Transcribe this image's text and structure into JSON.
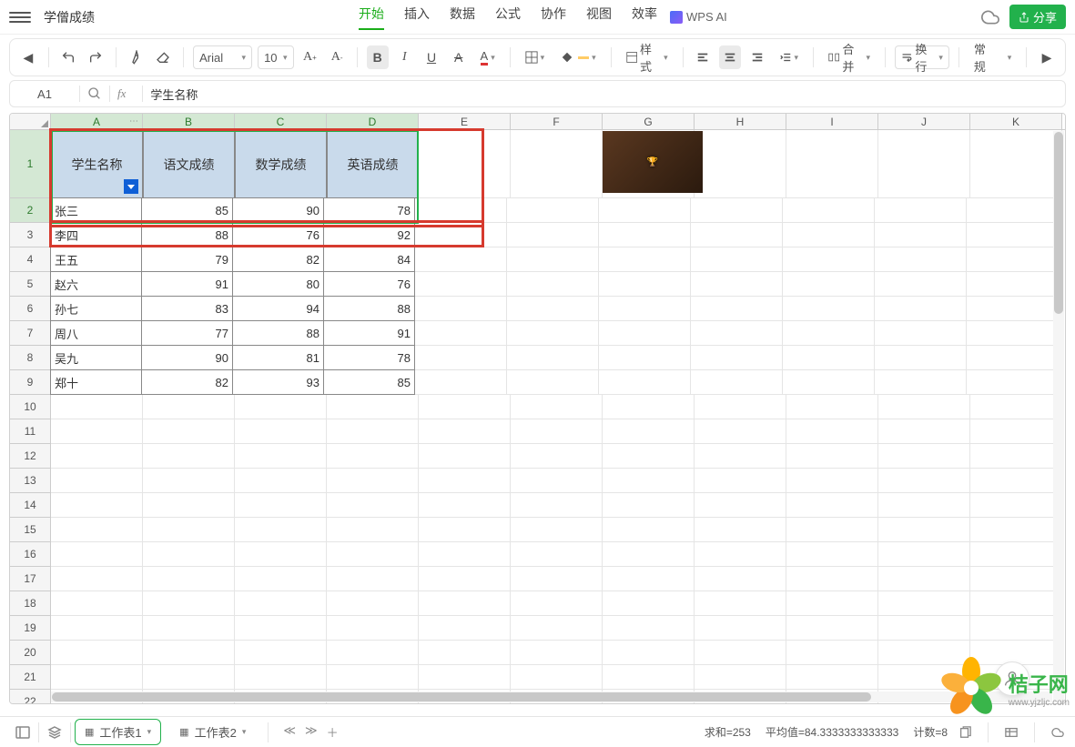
{
  "document_title": "学僧成绩",
  "menu": [
    "开始",
    "插入",
    "数据",
    "公式",
    "协作",
    "视图",
    "效率"
  ],
  "active_menu": 0,
  "wps_ai_label": "WPS AI",
  "share_label": "分享",
  "toolbar": {
    "font": "Arial",
    "font_size": "10",
    "style_label": "样式",
    "merge_label": "合并",
    "wrap_label": "换行",
    "format_label": "常规"
  },
  "formula_bar": {
    "cell_ref": "A1",
    "fx": "fx",
    "value": "学生名称"
  },
  "columns": [
    "A",
    "B",
    "C",
    "D",
    "E",
    "F",
    "G",
    "H",
    "I",
    "J",
    "K"
  ],
  "selected_cols": [
    "A",
    "B",
    "C",
    "D"
  ],
  "row_count": 22,
  "selected_rows": [
    1,
    2
  ],
  "headers": [
    "学生名称",
    "语文成绩",
    "数学成绩",
    "英语成绩"
  ],
  "students": [
    {
      "name": "张三",
      "c1": 85,
      "c2": 90,
      "c3": 78
    },
    {
      "name": "李四",
      "c1": 88,
      "c2": 76,
      "c3": 92
    },
    {
      "name": "王五",
      "c1": 79,
      "c2": 82,
      "c3": 84
    },
    {
      "name": "赵六",
      "c1": 91,
      "c2": 80,
      "c3": 76
    },
    {
      "name": "孙七",
      "c1": 83,
      "c2": 94,
      "c3": 88
    },
    {
      "name": "周八",
      "c1": 77,
      "c2": 88,
      "c3": 91
    },
    {
      "name": "吴九",
      "c1": 90,
      "c2": 81,
      "c3": 78
    },
    {
      "name": "郑十",
      "c1": 82,
      "c2": 93,
      "c3": 85
    }
  ],
  "sheet_tabs": [
    "工作表1",
    "工作表2"
  ],
  "active_sheet": 0,
  "status": {
    "sum_label": "求和=253",
    "avg_label": "平均值=84.3333333333333",
    "count_label": "计数=8"
  },
  "watermark": {
    "brand": "桔子网",
    "url": "www.yjzljc.com"
  },
  "chart_data": {
    "type": "table",
    "title": "学僧成绩",
    "columns": [
      "学生名称",
      "语文成绩",
      "数学成绩",
      "英语成绩"
    ],
    "rows": [
      [
        "张三",
        85,
        90,
        78
      ],
      [
        "李四",
        88,
        76,
        92
      ],
      [
        "王五",
        79,
        82,
        84
      ],
      [
        "赵六",
        91,
        80,
        76
      ],
      [
        "孙七",
        83,
        94,
        88
      ],
      [
        "周八",
        77,
        88,
        91
      ],
      [
        "吴九",
        90,
        81,
        78
      ],
      [
        "郑十",
        82,
        93,
        85
      ]
    ]
  }
}
